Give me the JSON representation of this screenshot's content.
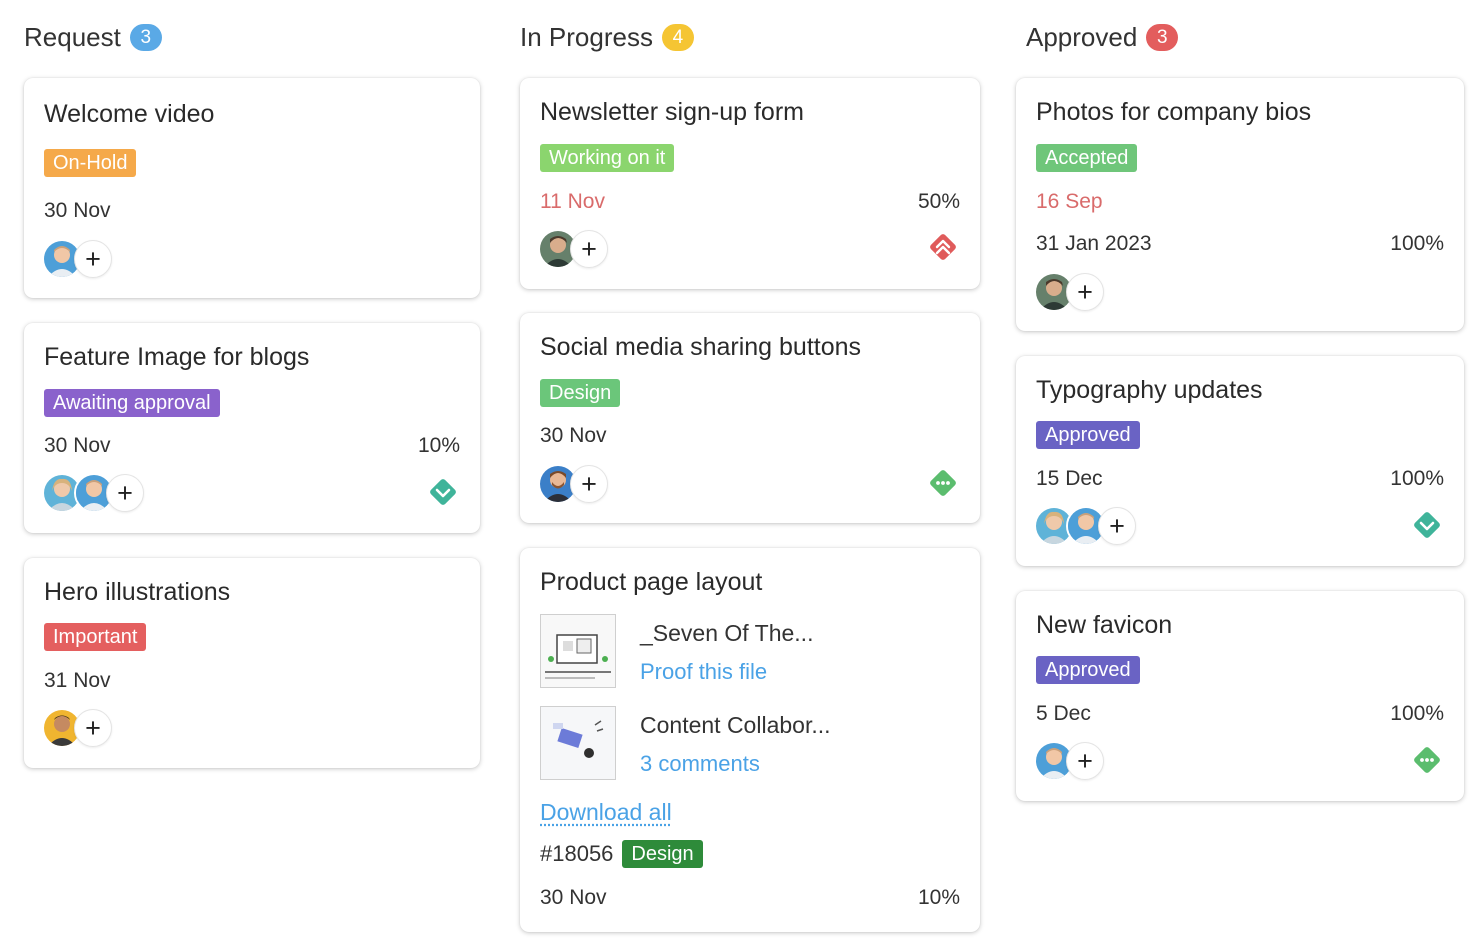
{
  "colors": {
    "request_badge": "#5aa9e6",
    "inprogress_badge": "#f5c533",
    "approved_badge": "#e35d5d",
    "tag_on_hold": "#f5a94a",
    "tag_working": "#8bd56e",
    "tag_awaiting": "#8a62cc",
    "tag_design": "#6bc67a",
    "tag_design_dark": "#2e8b3a",
    "tag_important": "#e45f5f",
    "tag_accepted": "#6fc67a",
    "tag_approved": "#6a63c4",
    "link": "#4aa2e6",
    "overdue": "#d96b6b",
    "priority_high": "#e05b5b",
    "priority_low": "#3fb49a",
    "priority_medium": "#5bbd6e"
  },
  "columns": [
    {
      "title": "Request",
      "count": "3",
      "cards": [
        {
          "title": "Welcome video",
          "tag": "On-Hold",
          "date": "30 Nov"
        },
        {
          "title": "Feature Image for blogs",
          "tag": "Awaiting approval",
          "date": "30 Nov",
          "percent": "10%",
          "priority_icon": "chevron-down-diamond-icon"
        },
        {
          "title": "Hero illustrations",
          "tag": "Important",
          "date": "31 Nov"
        }
      ]
    },
    {
      "title": "In Progress",
      "count": "4",
      "cards": [
        {
          "title": "Newsletter sign-up form",
          "tag": "Working on it",
          "date": "11 Nov",
          "percent": "50%",
          "priority_icon": "double-chevron-up-diamond-icon"
        },
        {
          "title": "Social media sharing buttons",
          "tag": "Design",
          "date": "30 Nov",
          "priority_icon": "dots-diamond-icon"
        },
        {
          "title": "Product page layout",
          "files": [
            {
              "name": "_Seven Of The...",
              "action": "Proof this file"
            },
            {
              "name": "Content Collabor...",
              "action": "3 comments"
            }
          ],
          "download": "Download all",
          "project_number": "#18056",
          "tag": "Design",
          "date": "30 Nov",
          "percent": "10%"
        }
      ]
    },
    {
      "title": "Approved",
      "count": "3",
      "cards": [
        {
          "title": "Photos for company bios",
          "tag": "Accepted",
          "start_date": "16 Sep",
          "date": "31 Jan 2023",
          "percent": "100%"
        },
        {
          "title": "Typography updates",
          "tag": "Approved",
          "date": "15 Dec",
          "percent": "100%",
          "priority_icon": "chevron-down-diamond-icon"
        },
        {
          "title": "New favicon",
          "tag": "Approved",
          "date": "5 Dec",
          "percent": "100%",
          "priority_icon": "dots-diamond-icon"
        }
      ]
    }
  ]
}
